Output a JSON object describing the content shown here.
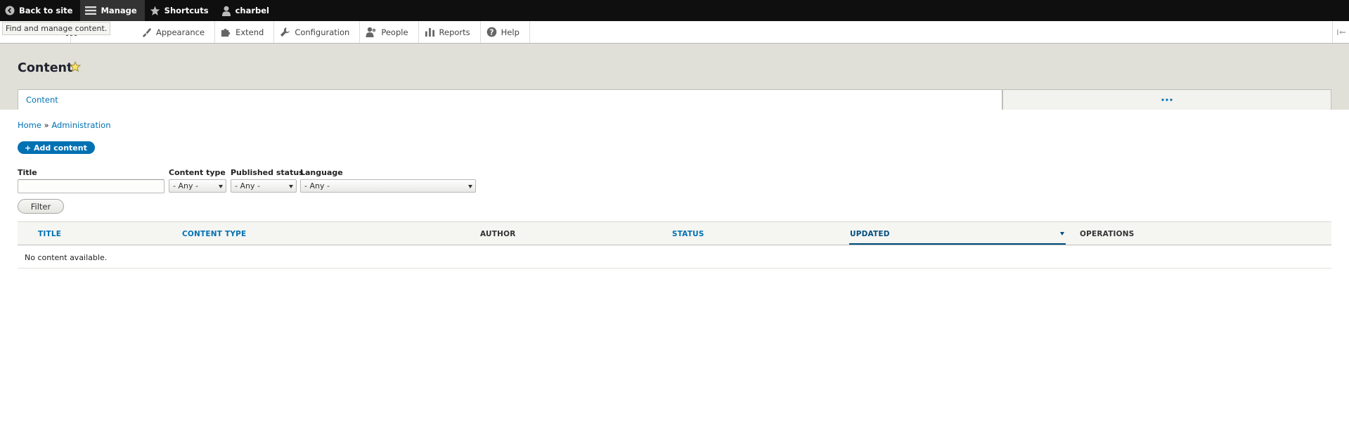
{
  "toolbar": {
    "back_to_site": "Back to site",
    "manage": "Manage",
    "shortcuts": "Shortcuts",
    "user": "charbel"
  },
  "tooltip": "Find and manage content.",
  "tray": {
    "structure_partial": "re",
    "appearance": "Appearance",
    "extend": "Extend",
    "configuration": "Configuration",
    "people": "People",
    "reports": "Reports",
    "help": "Help"
  },
  "page": {
    "title": "Content"
  },
  "tabs": {
    "primary": "Content",
    "more": "•••"
  },
  "breadcrumb": {
    "home": "Home",
    "separator": "»",
    "administration": "Administration"
  },
  "add_content_button": "+ Add content",
  "filters": {
    "title_label": "Title",
    "title_value": "",
    "content_type_label": "Content type",
    "content_type_value": "- Any -",
    "status_label": "Published status",
    "status_value": "- Any -",
    "language_label": "Language",
    "language_value": "- Any -",
    "filter_button": "Filter"
  },
  "table": {
    "headers": {
      "title": "TITLE",
      "content_type": "CONTENT TYPE",
      "author": "AUTHOR",
      "status": "STATUS",
      "updated": "UPDATED",
      "operations": "OPERATIONS"
    },
    "empty_message": "No content available."
  },
  "colors": {
    "link": "#0071b3",
    "toolbar_bg": "#0f0f0f",
    "header_bg": "#e0e0d8",
    "primary_button": "#0071b3"
  }
}
